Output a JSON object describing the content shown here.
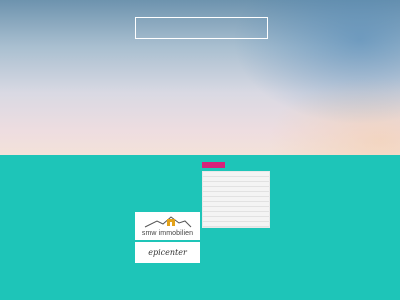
{
  "search": {
    "placeholder": ""
  },
  "logos": [
    {
      "name": "smw immobilien",
      "icon": "house-roof-icon",
      "accent": "#e3a21a"
    },
    {
      "name": "epicenter",
      "icon": "handwritten-logo"
    }
  ],
  "colors": {
    "teal": "#1ec5b8",
    "marker": "#d6227a"
  }
}
